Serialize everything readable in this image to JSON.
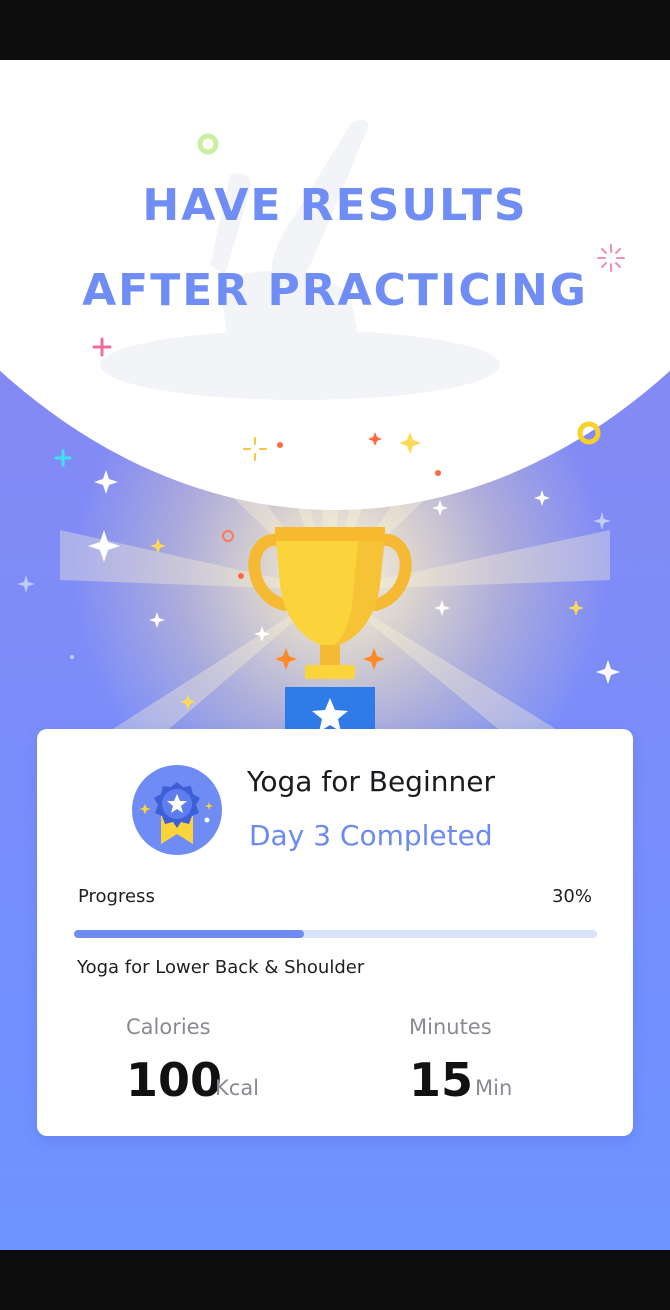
{
  "hero": {
    "title_line1": "HAVE RESULTS",
    "title_line2": "AFTER PRACTICING",
    "title_color": "#6f8df4",
    "background_top": "#ffffff",
    "background_bottom": "#6d94ff"
  },
  "trophy": {
    "icon": "trophy-icon",
    "cup_color": "#fbd33b",
    "base_color": "#2f7be8"
  },
  "card": {
    "badge_icon": "medal-badge-icon",
    "course_title": "Yoga for Beginner",
    "day_status": "Day 3 Completed",
    "accent_color": "#6c8af3",
    "progress": {
      "label": "Progress",
      "value_text": "30%",
      "fraction": 0.44
    },
    "workout_name": "Yoga for Lower Back & Shoulder",
    "stats": {
      "calories": {
        "label": "Calories",
        "value": "100",
        "unit": "Kcal"
      },
      "minutes": {
        "label": "Minutes",
        "value": "15",
        "unit": "Min"
      }
    }
  }
}
